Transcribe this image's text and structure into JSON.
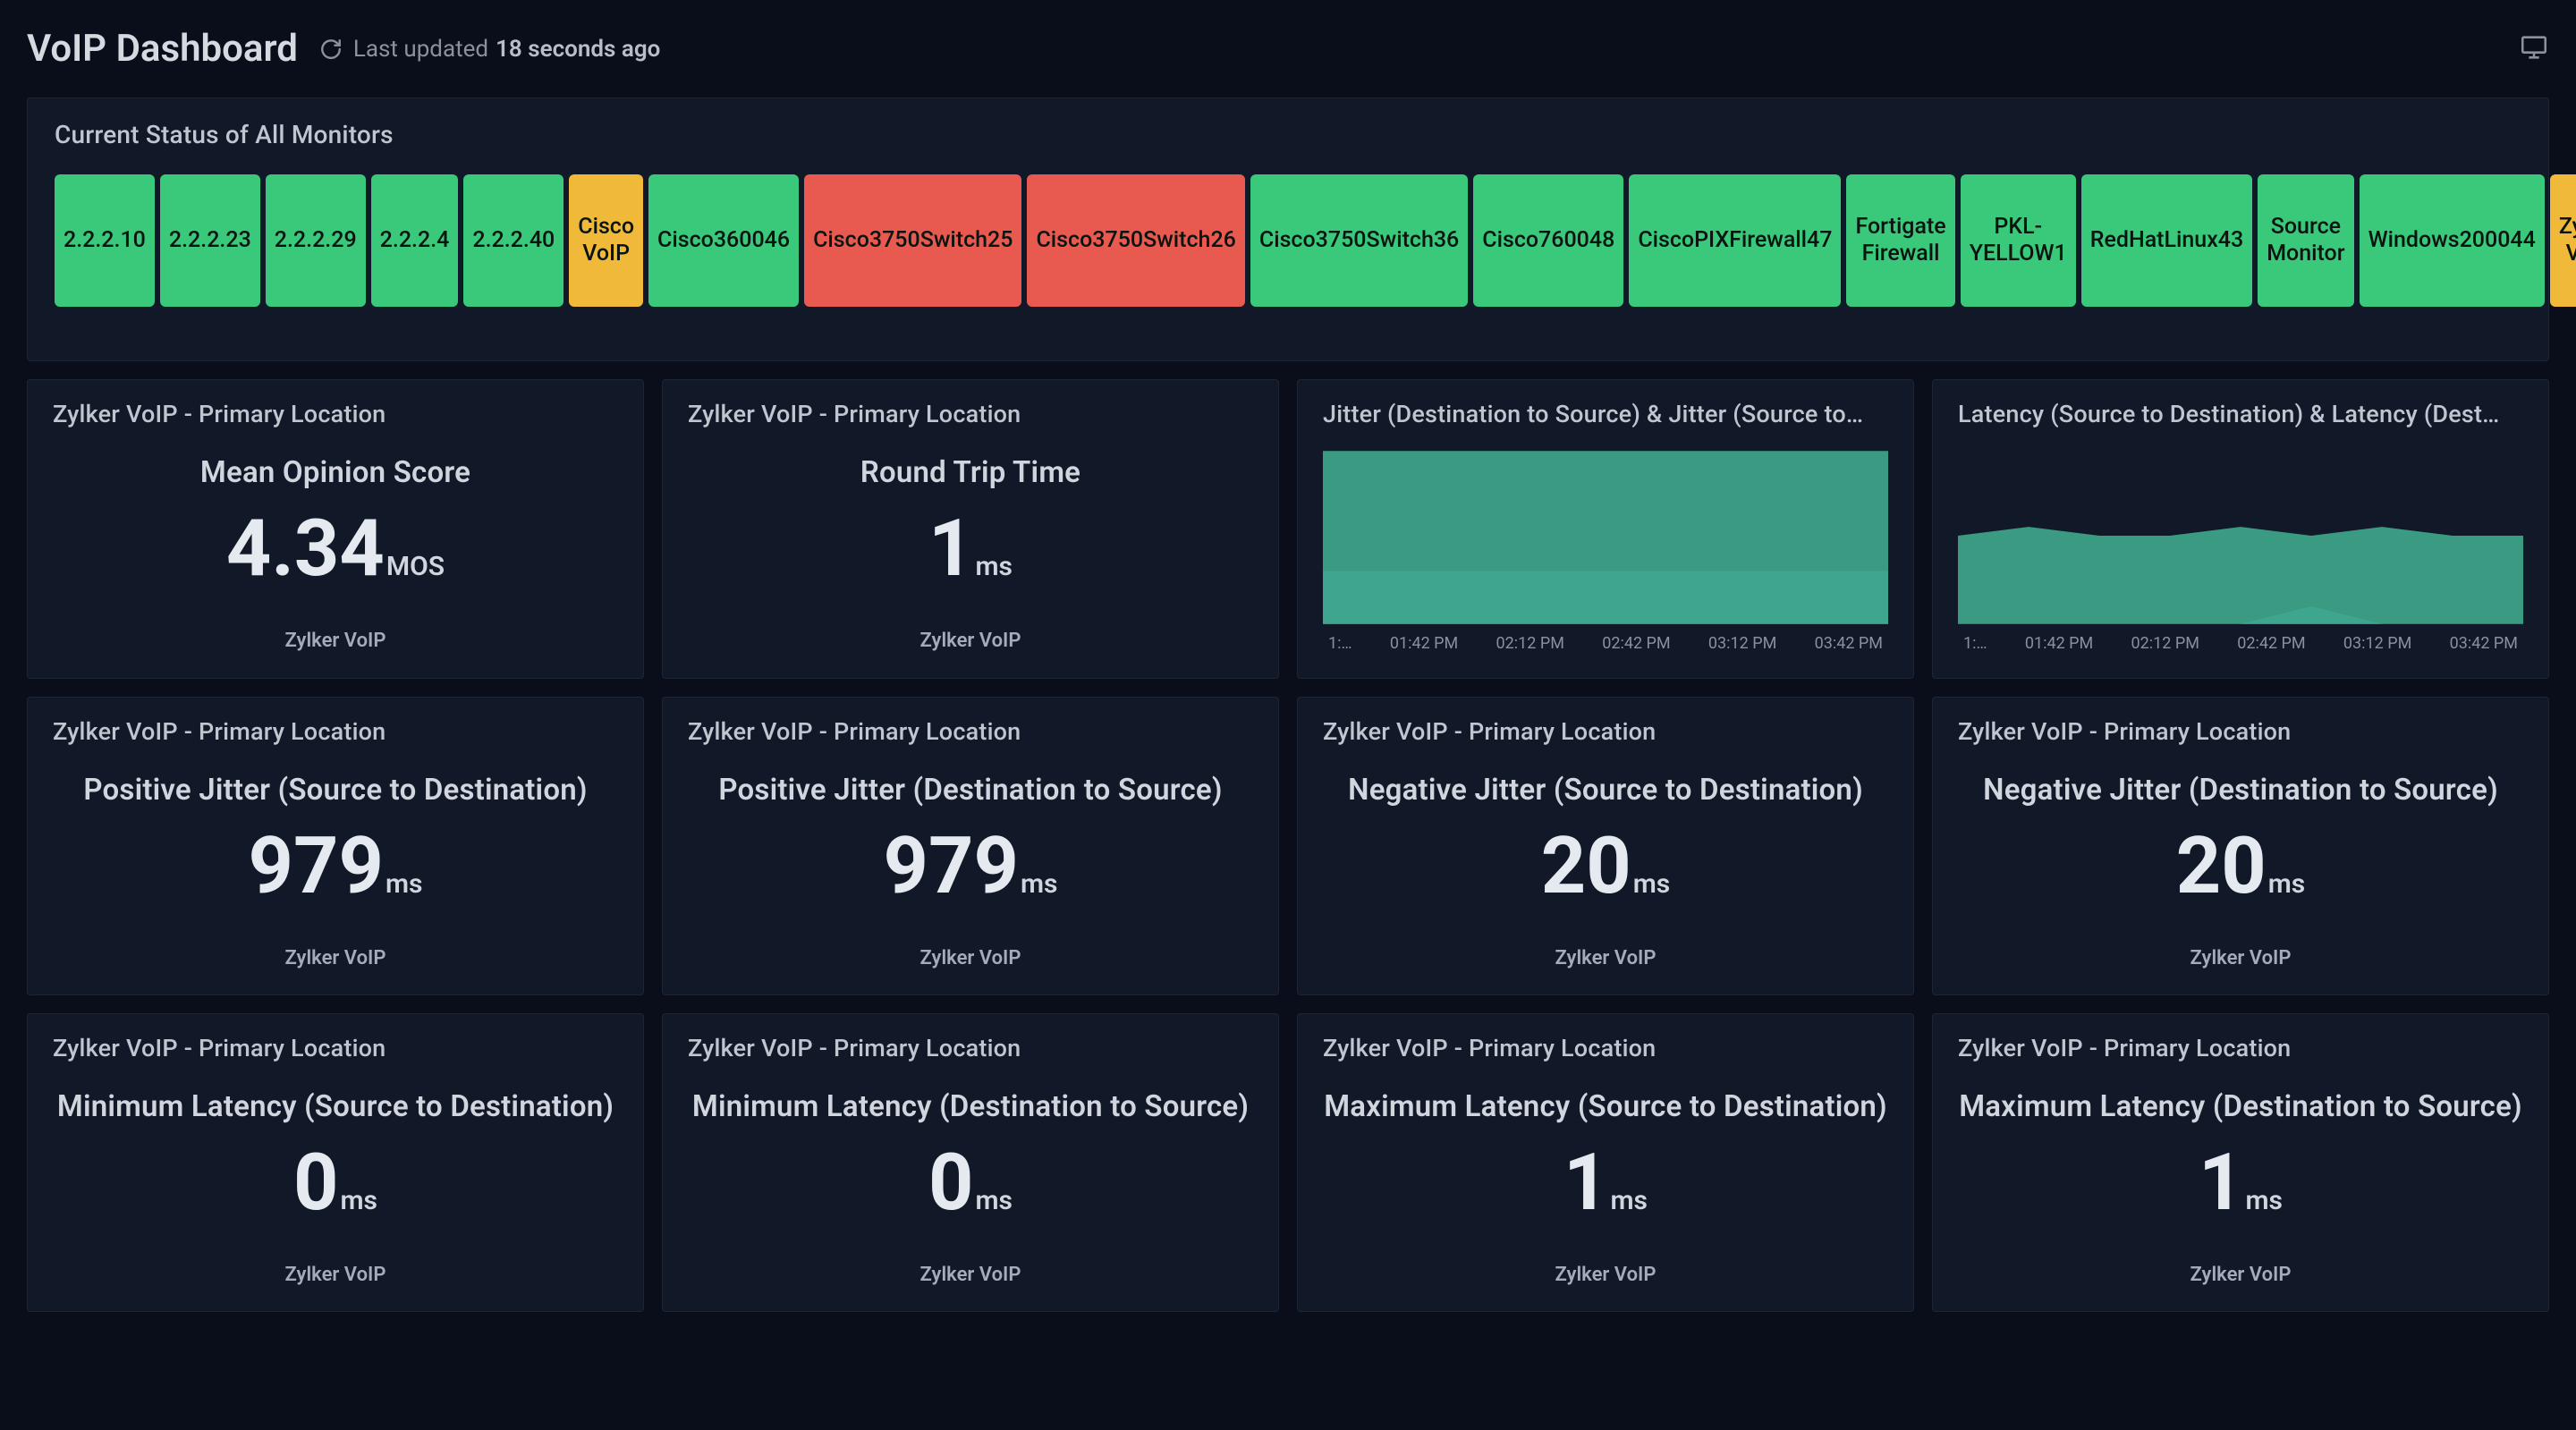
{
  "header": {
    "title": "VoIP Dashboard",
    "last_updated_label": "Last updated",
    "last_updated_value": "18 seconds ago"
  },
  "status_panel": {
    "title": "Current Status of All Monitors",
    "tiles": [
      {
        "label": "2.2.2.10",
        "status": "green"
      },
      {
        "label": "2.2.2.23",
        "status": "green"
      },
      {
        "label": "2.2.2.29",
        "status": "green"
      },
      {
        "label": "2.2.2.4",
        "status": "green"
      },
      {
        "label": "2.2.2.40",
        "status": "green"
      },
      {
        "label": "Cisco VoIP",
        "status": "yellow"
      },
      {
        "label": "Cisco360046",
        "status": "green"
      },
      {
        "label": "Cisco3750Switch25",
        "status": "red"
      },
      {
        "label": "Cisco3750Switch26",
        "status": "red"
      },
      {
        "label": "Cisco3750Switch36",
        "status": "green"
      },
      {
        "label": "Cisco760048",
        "status": "green"
      },
      {
        "label": "CiscoPIXFirewall47",
        "status": "green"
      },
      {
        "label": "Fortigate Firewall",
        "status": "green"
      },
      {
        "label": "PKL-YELLOW1",
        "status": "green"
      },
      {
        "label": "RedHatLinux43",
        "status": "green"
      },
      {
        "label": "Source Monitor",
        "status": "green"
      },
      {
        "label": "Windows200044",
        "status": "green"
      },
      {
        "label": "Zylker VoIP",
        "status": "yellow"
      }
    ]
  },
  "metrics": [
    {
      "header": "Zylker VoIP - Primary Location",
      "title": "Mean Opinion Score",
      "value": "4.34",
      "unit": "MOS",
      "source": "Zylker VoIP",
      "kind": "value"
    },
    {
      "header": "Zylker VoIP - Primary Location",
      "title": "Round Trip Time",
      "value": "1",
      "unit": "ms",
      "source": "Zylker VoIP",
      "kind": "value"
    },
    {
      "header": "Jitter (Destination to Source) & Jitter (Source to…",
      "kind": "chart",
      "chart_index": 0
    },
    {
      "header": "Latency (Source to Destination) & Latency (Dest…",
      "kind": "chart",
      "chart_index": 1
    },
    {
      "header": "Zylker VoIP - Primary Location",
      "title": "Positive Jitter (Source to Destination)",
      "value": "979",
      "unit": "ms",
      "source": "Zylker VoIP",
      "kind": "value"
    },
    {
      "header": "Zylker VoIP - Primary Location",
      "title": "Positive Jitter (Destination to Source)",
      "value": "979",
      "unit": "ms",
      "source": "Zylker VoIP",
      "kind": "value"
    },
    {
      "header": "Zylker VoIP - Primary Location",
      "title": "Negative Jitter (Source to Destination)",
      "value": "20",
      "unit": "ms",
      "source": "Zylker VoIP",
      "kind": "value"
    },
    {
      "header": "Zylker VoIP - Primary Location",
      "title": "Negative Jitter (Destination to Source)",
      "value": "20",
      "unit": "ms",
      "source": "Zylker VoIP",
      "kind": "value"
    },
    {
      "header": "Zylker VoIP - Primary Location",
      "title": "Minimum Latency (Source to Destination)",
      "value": "0",
      "unit": "ms",
      "source": "Zylker VoIP",
      "kind": "value"
    },
    {
      "header": "Zylker VoIP - Primary Location",
      "title": "Minimum Latency (Destination to Source)",
      "value": "0",
      "unit": "ms",
      "source": "Zylker VoIP",
      "kind": "value"
    },
    {
      "header": "Zylker VoIP - Primary Location",
      "title": "Maximum Latency (Source to Destination)",
      "value": "1",
      "unit": "ms",
      "source": "Zylker VoIP",
      "kind": "value"
    },
    {
      "header": "Zylker VoIP - Primary Location",
      "title": "Maximum Latency (Destination to Source)",
      "value": "1",
      "unit": "ms",
      "source": "Zylker VoIP",
      "kind": "value"
    }
  ],
  "colors": {
    "green": "#3ac97a",
    "yellow": "#f0b93a",
    "red": "#e85a4f",
    "chart_series_a": "#3ea78a",
    "chart_series_b": "#4aa7c4"
  },
  "chart_data": [
    {
      "type": "area",
      "title": "Jitter (Destination to Source) & Jitter (Source to Destination)",
      "x_labels": [
        "1:…",
        "01:42 PM",
        "02:12 PM",
        "02:42 PM",
        "03:12 PM",
        "03:42 PM"
      ],
      "ylim": [
        0,
        1000
      ],
      "series": [
        {
          "name": "Jitter (Destination to Source)",
          "color": "#3ea78a",
          "values": [
            980,
            980,
            980,
            980,
            980,
            980
          ]
        },
        {
          "name": "Jitter (Source to Destination)",
          "color": "#4aa7c4",
          "values": [
            300,
            300,
            300,
            300,
            300,
            300
          ]
        }
      ]
    },
    {
      "type": "area",
      "title": "Latency (Source to Destination) & Latency (Destination to Source)",
      "x_labels": [
        "1:…",
        "01:42 PM",
        "02:12 PM",
        "02:42 PM",
        "03:12 PM",
        "03:42 PM"
      ],
      "ylim": [
        0,
        2
      ],
      "series": [
        {
          "name": "Latency (Source to Destination)",
          "color": "#3ea78a",
          "values": [
            1.0,
            1.1,
            1.0,
            1.0,
            1.1,
            1.0,
            1.1,
            1.0,
            1.0
          ]
        },
        {
          "name": "Latency (Destination to Source)",
          "color": "#4aa7c4",
          "values": [
            0,
            0,
            0,
            0,
            0,
            0.2,
            0,
            0,
            0
          ]
        }
      ]
    }
  ]
}
